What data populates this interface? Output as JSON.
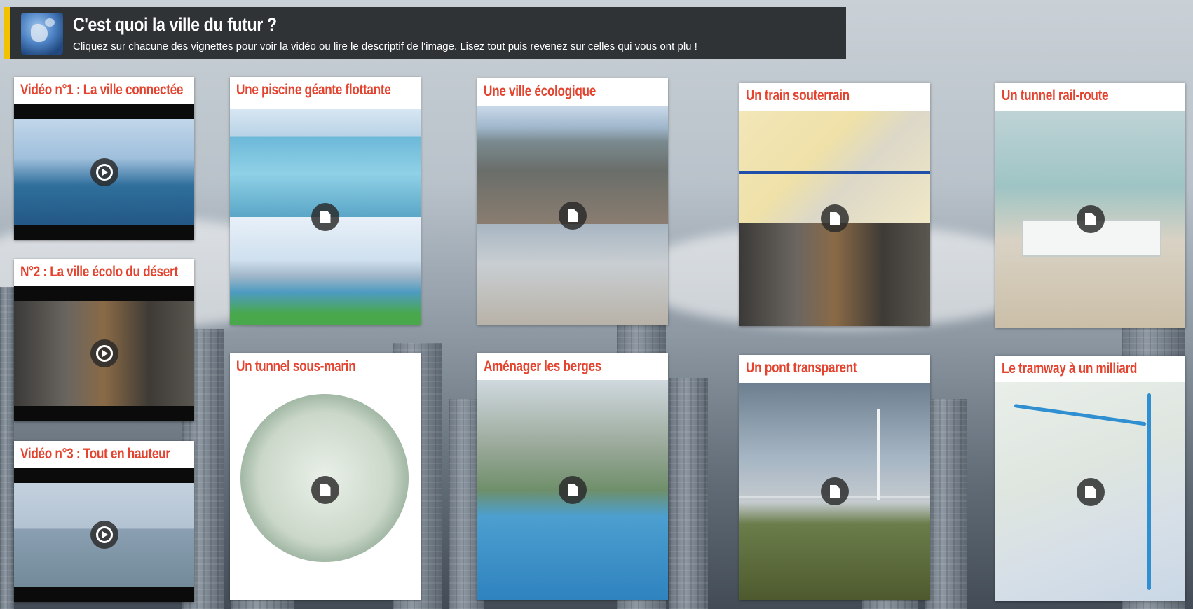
{
  "header": {
    "title": "C'est quoi la ville du futur ?",
    "subtitle": "Cliquez sur chacune des vignettes pour voir la vidéo ou lire le descriptif de l'image. Lisez tout puis revenez sur celles qui vous ont plu !",
    "accent_color": "#f2c200",
    "icon": "globe-icon"
  },
  "cards": [
    {
      "title": "Vidéo n°1 : La ville connectée",
      "kind": "video",
      "icon": "play-icon"
    },
    {
      "title": "N°2 : La ville écolo du désert",
      "kind": "video",
      "icon": "play-icon"
    },
    {
      "title": "Vidéo n°3 : Tout en hauteur",
      "kind": "video",
      "icon": "play-icon"
    },
    {
      "title": "Une piscine géante flottante",
      "kind": "image",
      "icon": "document-icon"
    },
    {
      "title": "Un tunnel sous-marin",
      "kind": "image",
      "icon": "document-icon"
    },
    {
      "title": "Une ville écologique",
      "kind": "image",
      "icon": "document-icon"
    },
    {
      "title": "Aménager les berges",
      "kind": "image",
      "icon": "document-icon"
    },
    {
      "title": "Un train souterrain",
      "kind": "image",
      "icon": "document-icon"
    },
    {
      "title": "Un pont transparent",
      "kind": "image",
      "icon": "document-icon"
    },
    {
      "title": "Un tunnel rail-route",
      "kind": "image",
      "icon": "document-icon"
    },
    {
      "title": "Le tramway à un milliard",
      "kind": "image",
      "icon": "document-icon"
    }
  ],
  "colors": {
    "card_title": "#e4442f",
    "header_bg": "#2f3336"
  }
}
